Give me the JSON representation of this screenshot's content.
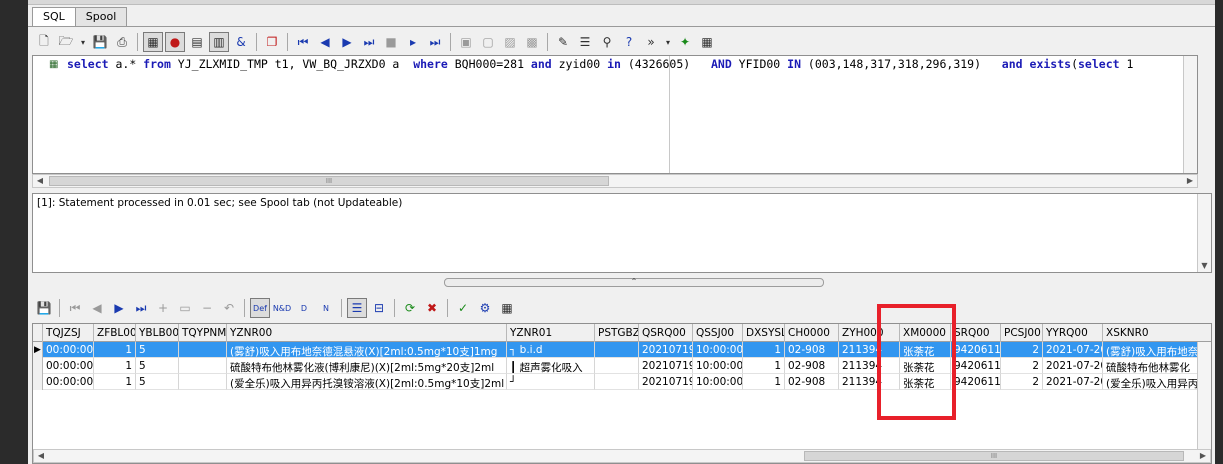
{
  "tabs": [
    {
      "label": "SQL",
      "active": true
    },
    {
      "label": "Spool",
      "active": false
    }
  ],
  "editor": {
    "sql_parts": [
      {
        "t": "select",
        "k": true
      },
      {
        "t": " a.* ",
        "k": false
      },
      {
        "t": "from",
        "k": true
      },
      {
        "t": " YJ_ZLXMID_TMP t1, VW_BQ_JRZXD0 a  ",
        "k": false
      },
      {
        "t": "where",
        "k": true
      },
      {
        "t": " BQH000=281 ",
        "k": false
      },
      {
        "t": "and",
        "k": true
      },
      {
        "t": " zyid00 ",
        "k": false
      },
      {
        "t": "in",
        "k": true
      },
      {
        "t": " (4326605)   ",
        "k": false
      },
      {
        "t": "AND",
        "k": true
      },
      {
        "t": " YFID00 ",
        "k": false
      },
      {
        "t": "IN",
        "k": true
      },
      {
        "t": " (003,148,317,318,296,319)   ",
        "k": false
      },
      {
        "t": "and",
        "k": true
      },
      {
        "t": " ",
        "k": false
      },
      {
        "t": "exists",
        "k": true
      },
      {
        "t": "(",
        "k": false
      },
      {
        "t": "select",
        "k": true
      },
      {
        "t": " 1",
        "k": false
      }
    ]
  },
  "message": {
    "text": "[1]: Statement processed in 0.01 sec; see Spool tab (not Updateable)"
  },
  "grid": {
    "columns": [
      "TQJZSJ",
      "ZFBL00",
      "YBLB00",
      "TQYPNM",
      "YZNR00",
      "YZNR01",
      "PSTGBZ",
      "QSRQ00",
      "QSSJ00",
      "DXSYSL",
      "CH0000",
      "ZYH000",
      "XM0000",
      "SRQ00",
      "PCSJ00",
      "YYRQ00",
      "XSKNR0"
    ],
    "rows": [
      [
        "00:00:00",
        "1",
        "5",
        "",
        "(雾舒)吸入用布地奈德混悬液(X)[2ml:0.5mg*10支]1mg",
        "┐ b.i.d",
        "",
        "20210719",
        "10:00:00",
        "1",
        "02-908",
        "211394",
        "张荼花",
        "9420611",
        "2",
        "2021-07-20",
        "(雾舒)吸入用布地奈"
      ],
      [
        "00:00:00",
        "1",
        "5",
        "",
        "硫酸特布他林雾化液(博利康尼)(X)[2ml:5mg*20支]2ml",
        "┃ 超声雾化吸入",
        "",
        "20210719",
        "10:00:00",
        "1",
        "02-908",
        "211394",
        "张荼花",
        "9420611",
        "2",
        "2021-07-20",
        "硫酸特布他林雾化"
      ],
      [
        "00:00:00",
        "1",
        "5",
        "",
        "(爱全乐)吸入用异丙托溴铵溶液(X)[2ml:0.5mg*10支]2ml",
        "┘",
        "",
        "20210719",
        "10:00:00",
        "1",
        "02-908",
        "211394",
        "张荼花",
        "9420611",
        "2",
        "2021-07-20",
        "(爱全乐)吸入用异丙"
      ]
    ],
    "selected_row": 0
  },
  "colors": {
    "selection": "#3296f0",
    "keyword": "#1b1bb6",
    "highlight_box": "#e8202a"
  },
  "icons": {
    "editor_toolbar": [
      "new-file-icon",
      "open-sql-icon",
      "save-icon",
      "print-icon",
      "query-builder-icon",
      "stop-execute-icon",
      "explain-plan-icon",
      "bind-variables-icon",
      "link-icon",
      "copy-icon",
      "first-record-icon",
      "prior-record-icon",
      "play-icon",
      "next-icon",
      "stop-icon",
      "step-icon",
      "last-icon",
      "commit-icon",
      "rollback-icon",
      "import-icon",
      "export-icon",
      "debug-icon",
      "list-icon",
      "find-icon",
      "help-icon",
      "markers-icon",
      "tools-icon",
      "grid-icon"
    ],
    "grid_toolbar": [
      "save-icon",
      "first-icon",
      "prior-icon",
      "next-icon",
      "last-icon",
      "insert-icon",
      "edit-icon",
      "delete-icon",
      "undo-icon",
      "default-values-icon",
      "n-d-icon",
      "d-icon",
      "n-icon",
      "list-view-icon",
      "filter-icon",
      "refresh-icon",
      "cancel-icon",
      "sum-icon",
      "settings-icon",
      "export-grid-icon"
    ]
  }
}
